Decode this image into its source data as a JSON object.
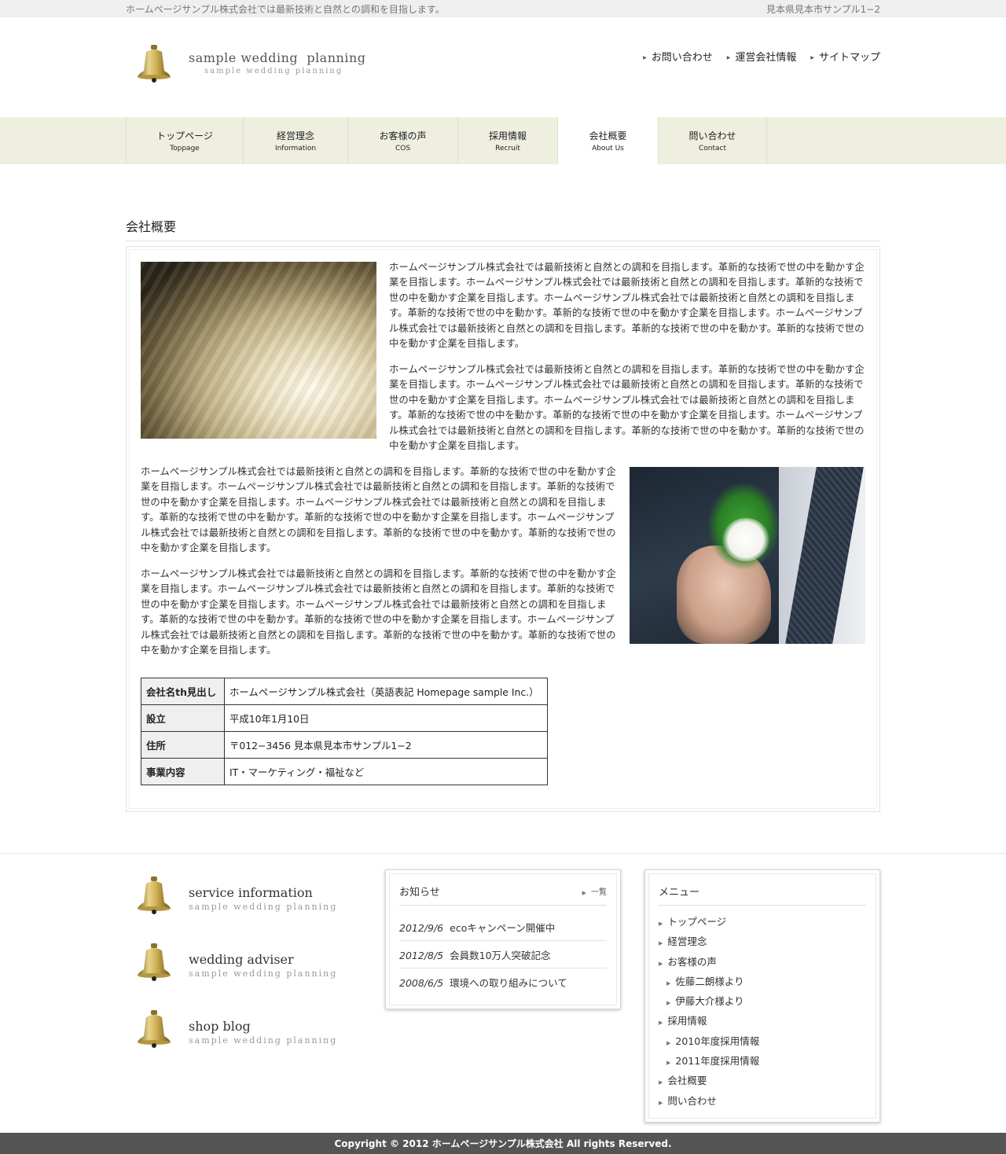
{
  "topbar": {
    "tagline": "ホームページサンプル株式会社では最新技術と自然との調和を目指します。",
    "address": "見本県見本市サンプル1−2"
  },
  "header": {
    "logo_title": "sample wedding  planning",
    "logo_sub": "sample wedding planning",
    "utility_links": [
      "お問い合わせ",
      "運営会社情報",
      "サイトマップ"
    ]
  },
  "nav": {
    "items": [
      {
        "jp": "トップページ",
        "en": "Toppage",
        "width": 148
      },
      {
        "jp": "経営理念",
        "en": "Information",
        "width": 132
      },
      {
        "jp": "お客様の声",
        "en": "COS",
        "width": 139
      },
      {
        "jp": "採用情報",
        "en": "Recruit",
        "width": 126
      },
      {
        "jp": "会社概要",
        "en": "About Us",
        "width": 127
      },
      {
        "jp": "問い合わせ",
        "en": "Contact",
        "width": 137
      }
    ],
    "active": 4
  },
  "content": {
    "title": "会社概要",
    "paragraphs": [
      "ホームページサンプル株式会社では最新技術と自然との調和を目指します。革新的な技術で世の中を動かす企業を目指します。ホームページサンプル株式会社では最新技術と自然との調和を目指します。革新的な技術で世の中を動かす企業を目指します。ホームページサンプル株式会社では最新技術と自然との調和を目指します。革新的な技術で世の中を動かす。革新的な技術で世の中を動かす企業を目指します。ホームページサンプル株式会社では最新技術と自然との調和を目指します。革新的な技術で世の中を動かす。革新的な技術で世の中を動かす企業を目指します。",
      "ホームページサンプル株式会社では最新技術と自然との調和を目指します。革新的な技術で世の中を動かす企業を目指します。ホームページサンプル株式会社では最新技術と自然との調和を目指します。革新的な技術で世の中を動かす企業を目指します。ホームページサンプル株式会社では最新技術と自然との調和を目指します。革新的な技術で世の中を動かす。革新的な技術で世の中を動かす企業を目指します。ホームページサンプル株式会社では最新技術と自然との調和を目指します。革新的な技術で世の中を動かす。革新的な技術で世の中を動かす企業を目指します。",
      "ホームページサンプル株式会社では最新技術と自然との調和を目指します。革新的な技術で世の中を動かす企業を目指します。ホームページサンプル株式会社では最新技術と自然との調和を目指します。革新的な技術で世の中を動かす企業を目指します。ホームページサンプル株式会社では最新技術と自然との調和を目指します。革新的な技術で世の中を動かす。革新的な技術で世の中を動かす企業を目指します。ホームページサンプル株式会社では最新技術と自然との調和を目指します。革新的な技術で世の中を動かす。革新的な技術で世の中を動かす企業を目指します。",
      "ホームページサンプル株式会社では最新技術と自然との調和を目指します。革新的な技術で世の中を動かす企業を目指します。ホームページサンプル株式会社では最新技術と自然との調和を目指します。革新的な技術で世の中を動かす企業を目指します。ホームページサンプル株式会社では最新技術と自然との調和を目指します。革新的な技術で世の中を動かす。革新的な技術で世の中を動かす企業を目指します。ホームページサンプル株式会社では最新技術と自然との調和を目指します。革新的な技術で世の中を動かす。革新的な技術で世の中を動かす企業を目指します。"
    ],
    "table": [
      {
        "th": "会社名th見出し",
        "td": "ホームページサンプル株式会社（英語表記 Homepage sample Inc.）"
      },
      {
        "th": "設立",
        "td": "平成10年1月10日"
      },
      {
        "th": "住所",
        "td": "〒012−3456 見本県見本市サンプル1−2"
      },
      {
        "th": "事業内容",
        "td": "IT・マーケティング・福祉など"
      }
    ]
  },
  "footer": {
    "services": [
      {
        "title": "service information",
        "sub": "sample wedding planning"
      },
      {
        "title": "wedding adviser",
        "sub": "sample wedding planning"
      },
      {
        "title": "shop blog",
        "sub": "sample wedding planning"
      }
    ],
    "news": {
      "title": "お知らせ",
      "more": "一覧",
      "items": [
        {
          "date": "2012/9/6",
          "text": "ecoキャンペーン開催中"
        },
        {
          "date": "2012/8/5",
          "text": "会員数10万人突破記念"
        },
        {
          "date": "2008/6/5",
          "text": "環境への取り組みについて"
        }
      ]
    },
    "menu": {
      "title": "メニュー",
      "items": [
        {
          "label": "トップページ",
          "sub": false
        },
        {
          "label": "経営理念",
          "sub": false
        },
        {
          "label": "お客様の声",
          "sub": false
        },
        {
          "label": "佐藤二朗様より",
          "sub": true
        },
        {
          "label": "伊藤大介様より",
          "sub": true
        },
        {
          "label": "採用情報",
          "sub": false
        },
        {
          "label": "2010年度採用情報",
          "sub": true
        },
        {
          "label": "2011年度採用情報",
          "sub": true
        },
        {
          "label": "会社概要",
          "sub": false
        },
        {
          "label": "問い合わせ",
          "sub": false
        }
      ]
    },
    "copyright": "Copyright © 2012 ホームページサンプル株式会社 All rights Reserved."
  }
}
